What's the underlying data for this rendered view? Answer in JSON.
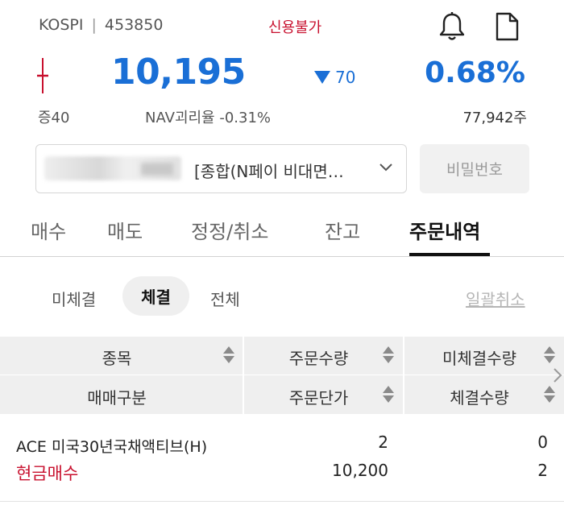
{
  "header": {
    "market": "KOSPI",
    "code": "453850",
    "credit_status": "신용불가",
    "icons": [
      "bell-icon",
      "document-icon"
    ]
  },
  "quote": {
    "price": "10,195",
    "change": "70",
    "change_direction": "down",
    "change_pct": "0.68%",
    "margin_rate": "증40",
    "nav_deviation": "NAV괴리율 -0.31%",
    "volume": "77,942주",
    "colors": {
      "down": "#1a6fd6",
      "up": "#c8102e"
    }
  },
  "account": {
    "name": "[종합(N페이 비대면…",
    "password_button": "비밀번호"
  },
  "tabs": [
    {
      "label": "매수"
    },
    {
      "label": "매도"
    },
    {
      "label": "정정/취소"
    },
    {
      "label": "잔고"
    },
    {
      "label": "주문내역",
      "active": true
    }
  ],
  "subtabs": [
    {
      "label": "미체결"
    },
    {
      "label": "체결",
      "active": true
    },
    {
      "label": "전체"
    }
  ],
  "bulk_cancel": "일괄취소",
  "table": {
    "header_row1": [
      "종목",
      "주문수량",
      "미체결수량"
    ],
    "header_row2": [
      "매매구분",
      "주문단가",
      "체결수량"
    ],
    "rows": [
      {
        "name": "ACE 미국30년국채액티브(H)",
        "type": "현금매수",
        "order_qty": "2",
        "order_price": "10,200",
        "unfilled_qty": "0",
        "filled_qty": "2"
      }
    ]
  }
}
